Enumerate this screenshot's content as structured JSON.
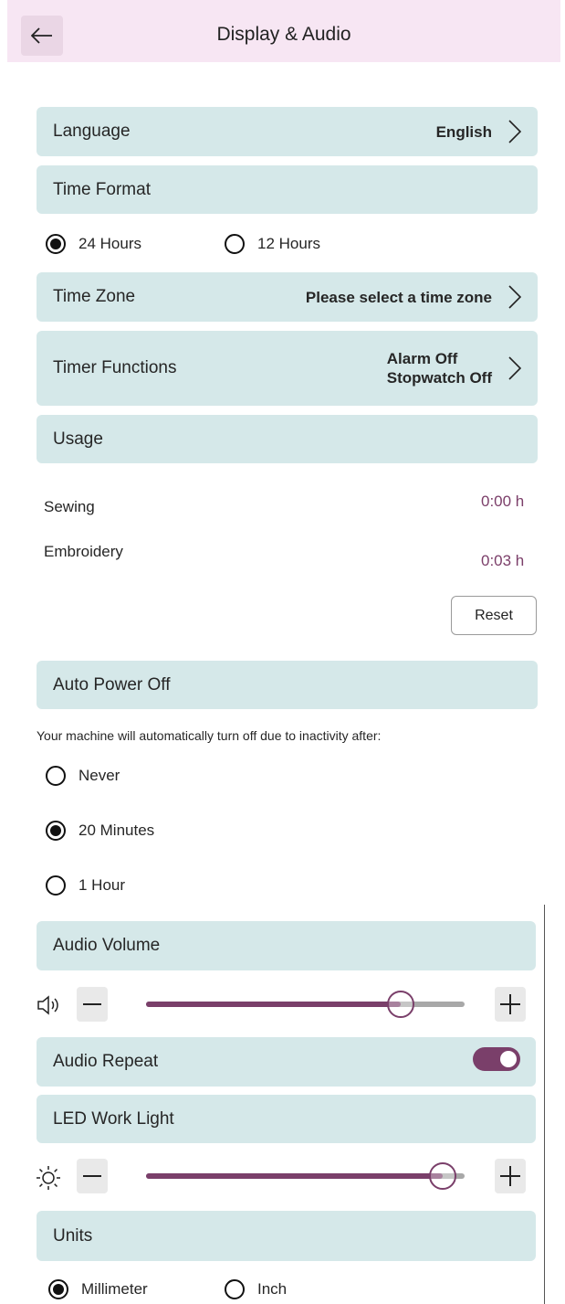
{
  "header": {
    "title": "Display & Audio"
  },
  "language": {
    "label": "Language",
    "value": "English"
  },
  "time_format": {
    "label": "Time Format",
    "options": [
      {
        "label": "24 Hours",
        "selected": true
      },
      {
        "label": "12 Hours",
        "selected": false
      }
    ]
  },
  "time_zone": {
    "label": "Time Zone",
    "value": "Please select a time zone"
  },
  "timer": {
    "label": "Timer Functions",
    "alarm": "Alarm Off",
    "stopwatch": "Stopwatch Off"
  },
  "usage": {
    "label": "Usage",
    "sewing_label": "Sewing",
    "sewing_value": "0:00 h",
    "embroidery_label": "Embroidery",
    "embroidery_value": "0:03 h",
    "reset_label": "Reset"
  },
  "auto_power_off": {
    "label": "Auto Power Off",
    "note": "Your machine will automatically turn off due to inactivity after:",
    "options": [
      {
        "label": "Never",
        "selected": false
      },
      {
        "label": "20 Minutes",
        "selected": true
      },
      {
        "label": "1 Hour",
        "selected": false
      }
    ]
  },
  "audio_volume": {
    "label": "Audio Volume",
    "level": 0.8
  },
  "audio_repeat": {
    "label": "Audio Repeat",
    "enabled": true
  },
  "led_work_light": {
    "label": "LED Work Light",
    "level": 0.93
  },
  "units": {
    "label": "Units",
    "options": [
      {
        "label": "Millimeter",
        "selected": true
      },
      {
        "label": "Inch",
        "selected": false
      }
    ]
  },
  "colors": {
    "accent": "#7a3f6a",
    "section_bg": "#d5e8e9",
    "header_bg": "#f7e6f3"
  },
  "icons": [
    "back-arrow-icon",
    "chevron-right-icon",
    "speaker-icon",
    "sun-icon",
    "minus-icon",
    "plus-icon"
  ]
}
